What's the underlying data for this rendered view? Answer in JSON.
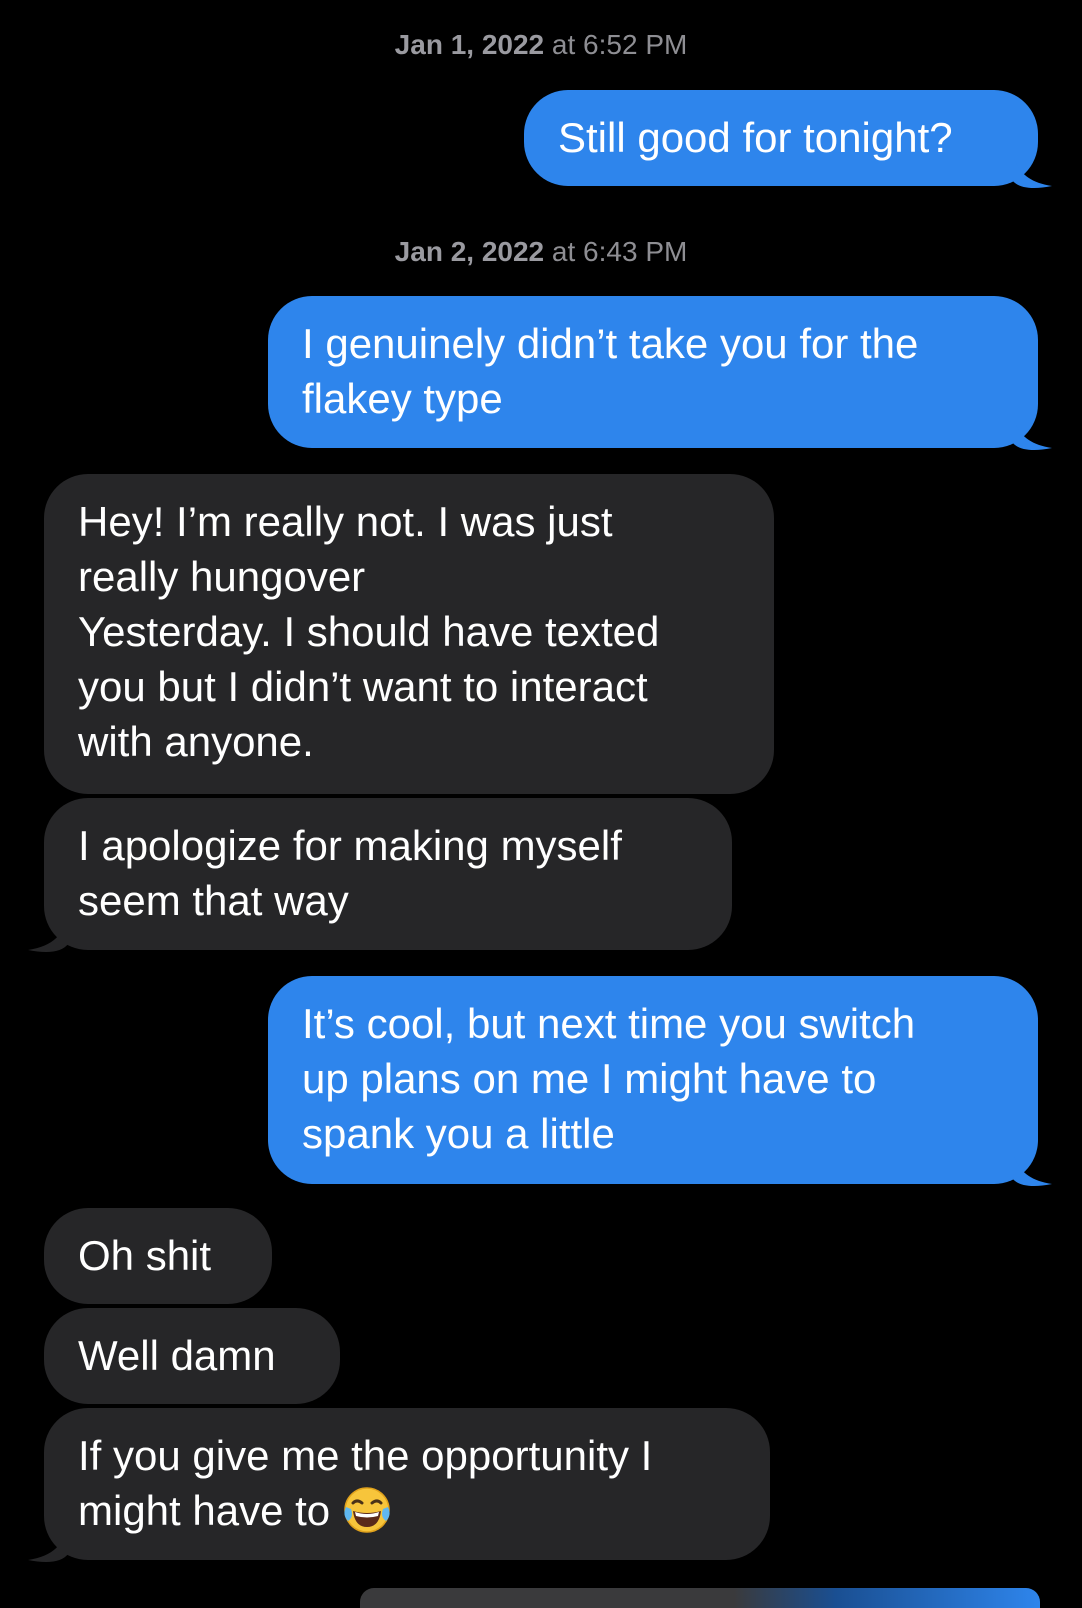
{
  "conversation": {
    "timestamps": [
      {
        "date": "Jan 1, 2022",
        "time": "at 6:52 PM"
      },
      {
        "date": "Jan 2, 2022",
        "time": "at 6:43 PM"
      }
    ],
    "messages": [
      {
        "direction": "sent",
        "lines": [
          "Still good for tonight?"
        ]
      },
      {
        "direction": "sent",
        "lines": [
          "I genuinely didn’t take you for the",
          "flakey type"
        ]
      },
      {
        "direction": "received",
        "lines": [
          "Hey! I’m really not. I was just",
          "really hungover",
          "Yesterday. I should have texted",
          "you but I didn’t want to interact",
          "with anyone."
        ]
      },
      {
        "direction": "received",
        "lines": [
          "I apologize for making myself",
          "seem that way"
        ]
      },
      {
        "direction": "sent",
        "lines": [
          "It’s cool, but next time you switch",
          "up plans on me I might have to",
          "spank you a little"
        ]
      },
      {
        "direction": "received",
        "lines": [
          "Oh shit"
        ]
      },
      {
        "direction": "received",
        "lines": [
          "Well damn"
        ]
      },
      {
        "direction": "received",
        "lines": [
          "If you give me the opportunity I",
          "might have to"
        ],
        "trailing_icon": "face-with-tears-of-joy-emoji"
      }
    ]
  },
  "colors": {
    "background": "#000000",
    "sent_bubble": "#2e85ec",
    "received_bubble": "#262628",
    "timestamp_text": "#8e8e93"
  }
}
